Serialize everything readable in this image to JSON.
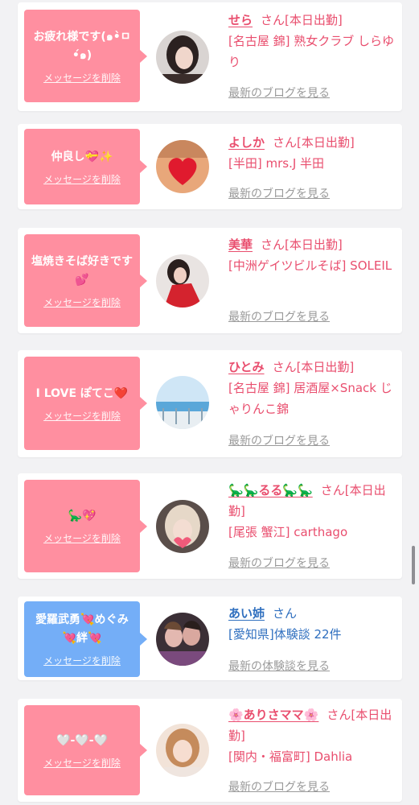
{
  "colors": {
    "pink_bubble": "#ff8fa0",
    "blue_bubble": "#74aef7",
    "pink_text": "#e94e6e",
    "blue_text": "#2f6fbf",
    "link_gray": "#9a9a9a"
  },
  "cards": [
    {
      "message": "お疲れ様です(๑•̀ㅁ•́๑)",
      "delete_label": "メッセージを削除",
      "name": "せら",
      "suffix": "さん[本日出勤]",
      "shop": "[名古屋 錦] 熟女クラブ しらゆり",
      "link": "最新のブログを見る",
      "theme": "pink",
      "avatar_icon": "woman-portrait-photo"
    },
    {
      "message": "仲良し💝✨",
      "delete_label": "メッセージを削除",
      "name": "よしか",
      "suffix": "さん[本日出勤]",
      "shop": "[半田] mrs.J 半田",
      "link": "最新のブログを見る",
      "theme": "pink",
      "avatar_icon": "heart-balloon-photo"
    },
    {
      "message": "塩焼きそば好きです💕",
      "delete_label": "メッセージを削除",
      "name": "美華",
      "suffix": "さん[本日出勤]",
      "shop": "[中洲ゲイツビルそば] SOLEIL",
      "link": "最新のブログを見る",
      "theme": "pink",
      "avatar_icon": "woman-red-dress-photo"
    },
    {
      "message": "I LOVE ぽてこ❤️",
      "delete_label": "メッセージを削除",
      "name": "ひとみ",
      "suffix": "さん[本日出勤]",
      "shop": "[名古屋 錦] 居酒屋×Snack じゃりんこ錦",
      "link": "最新のブログを見る",
      "theme": "pink",
      "avatar_icon": "seaside-view-photo"
    },
    {
      "message": "🦕💖",
      "delete_label": "メッセージを削除",
      "name": "🦕🦕るる🦕🦕",
      "suffix": "さん[本日出勤]",
      "shop": "[尾張 蟹江] carthago",
      "link": "最新のブログを見る",
      "theme": "pink",
      "avatar_icon": "woman-blonde-photo"
    },
    {
      "message": "愛羅武勇💘めぐみ💘絆💘",
      "delete_label": "メッセージを削除",
      "name": "あい姉",
      "suffix": "さん",
      "shop": "[愛知県]体験談 22件",
      "link": "最新の体験談を見る",
      "theme": "blue",
      "avatar_icon": "two-women-photo"
    },
    {
      "message": "🤍-🤍-🤍",
      "delete_label": "メッセージを削除",
      "name": "🌸ありさママ🌸",
      "suffix": "さん[本日出勤]",
      "shop": "[関内・福富町] Dahlia",
      "link": "最新のブログを見る",
      "theme": "pink",
      "avatar_icon": "woman-smiling-photo"
    }
  ]
}
